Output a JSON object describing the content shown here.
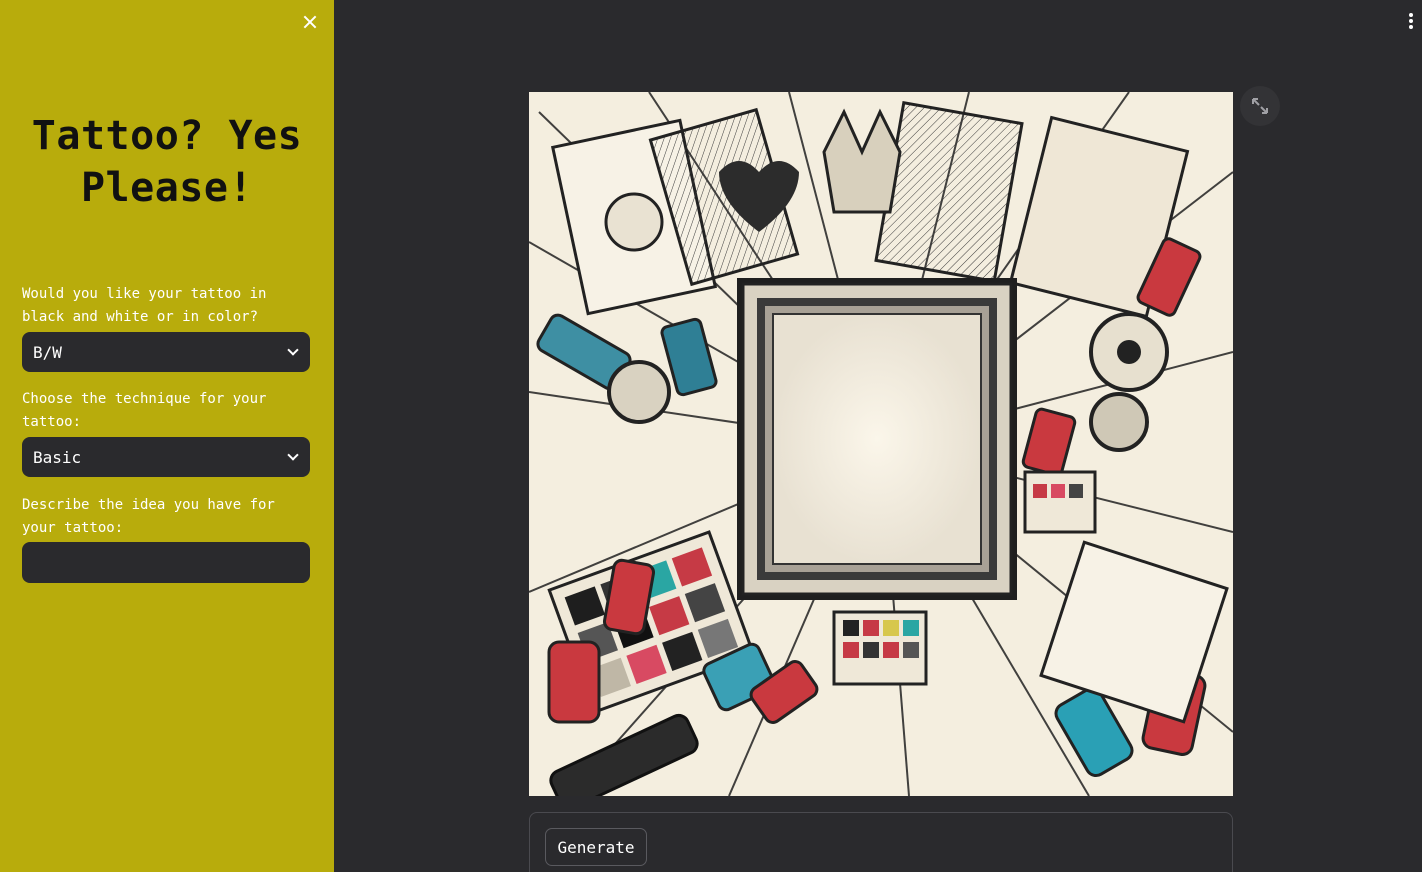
{
  "sidebar": {
    "title": "Tattoo? Yes Please!",
    "color_question": "Would you like your tattoo in black and white or in color?",
    "color_value": "B/W",
    "technique_question": "Choose the technique for your tattoo:",
    "technique_value": "Basic",
    "idea_question": "Describe the idea you have for your tattoo:",
    "idea_value": ""
  },
  "main": {
    "generate_label": "Generate"
  },
  "icons": [
    "close-icon",
    "chevron-down-icon",
    "more-vert-icon",
    "fullscreen-icon"
  ],
  "colors": {
    "sidebar_bg": "#b8ac0c",
    "main_bg": "#2a2a2d",
    "input_bg": "#2a2a2d"
  }
}
